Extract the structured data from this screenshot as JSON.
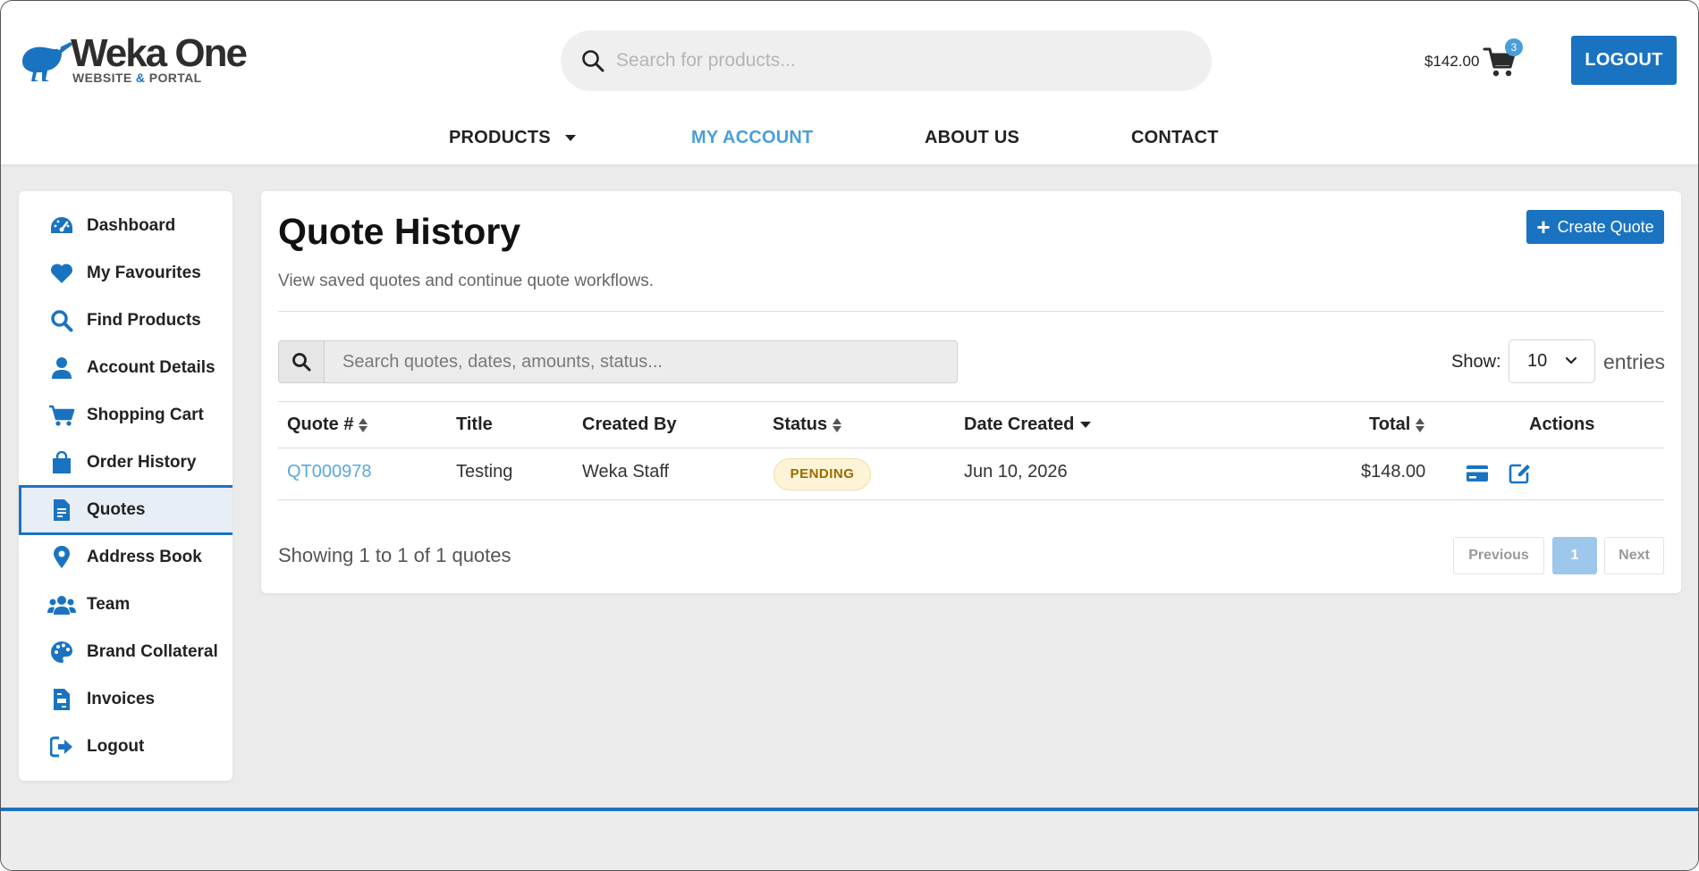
{
  "header": {
    "logo_title": "Weka One",
    "logo_sub_left": "WEBSITE",
    "logo_sub_amp": "&",
    "logo_sub_right": "PORTAL",
    "search_placeholder": "Search for products...",
    "cart_total": "$142.00",
    "cart_count": "3",
    "logout_label": "LOGOUT",
    "brand_color": "#1a73c1"
  },
  "nav": {
    "items": [
      {
        "label": "PRODUCTS",
        "has_dropdown": true
      },
      {
        "label": "MY ACCOUNT",
        "active": true
      },
      {
        "label": "ABOUT US"
      },
      {
        "label": "CONTACT"
      }
    ]
  },
  "sidebar": {
    "items": [
      {
        "label": "Dashboard",
        "icon": "gauge-icon"
      },
      {
        "label": "My Favourites",
        "icon": "heart-icon"
      },
      {
        "label": "Find Products",
        "icon": "search-icon"
      },
      {
        "label": "Account Details",
        "icon": "user-icon"
      },
      {
        "label": "Shopping Cart",
        "icon": "cart-icon"
      },
      {
        "label": "Order History",
        "icon": "shopping-bag-icon"
      },
      {
        "label": "Quotes",
        "icon": "document-icon",
        "active": true
      },
      {
        "label": "Address Book",
        "icon": "map-pin-icon"
      },
      {
        "label": "Team",
        "icon": "users-icon"
      },
      {
        "label": "Brand Collateral",
        "icon": "palette-icon"
      },
      {
        "label": "Invoices",
        "icon": "invoice-icon"
      },
      {
        "label": "Logout",
        "icon": "sign-out-icon"
      }
    ]
  },
  "main": {
    "title": "Quote History",
    "subtitle": "View saved quotes and continue quote workflows.",
    "create_label": "Create Quote",
    "search_placeholder": "Search quotes, dates, amounts, status...",
    "show_label": "Show:",
    "show_value": "10",
    "entries_label": "entries",
    "columns": [
      "Quote #",
      "Title",
      "Created By",
      "Status",
      "Date Created",
      "Total",
      "Actions"
    ],
    "rows": [
      {
        "quote": "QT000978",
        "title": "Testing",
        "created_by": "Weka Staff",
        "status": "PENDING",
        "date": "Jun 10, 2026",
        "total": "$148.00"
      }
    ],
    "showing_text": "Showing 1 to 1 of 1 quotes",
    "pagination": {
      "previous": "Previous",
      "current": "1",
      "next": "Next"
    }
  }
}
